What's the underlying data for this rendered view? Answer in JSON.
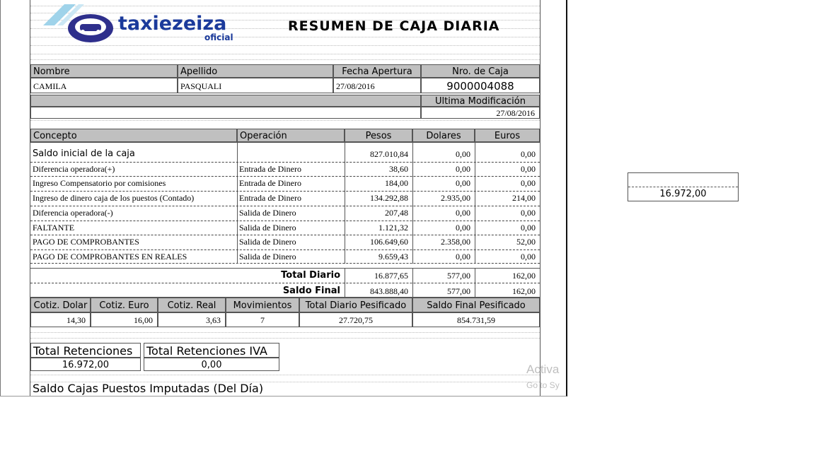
{
  "header": {
    "brand": "taxiezeiza",
    "brand_sub": "oficial",
    "title": "RESUMEN DE CAJA DIARIA"
  },
  "info": {
    "labels": {
      "nombre": "Nombre",
      "apellido": "Apellido",
      "fecha": "Fecha Apertura",
      "nro_caja": "Nro. de Caja",
      "ultima": "Ultima Modificación"
    },
    "nombre": "CAMILA",
    "apellido": "PASQUALI",
    "fecha": "27/08/2016",
    "nro_caja": "9000004088",
    "ultima": "27/08/2016"
  },
  "table": {
    "columns": [
      "Concepto",
      "Operación",
      "Pesos",
      "Dolares",
      "Euros"
    ],
    "rows": [
      {
        "concepto": "Saldo inicial de la caja",
        "operacion": "",
        "pesos": "827.010,84",
        "dolares": "0,00",
        "euros": "0,00"
      },
      {
        "concepto": "Diferencia operadora(+)",
        "operacion": "Entrada de Dinero",
        "pesos": "38,60",
        "dolares": "0,00",
        "euros": "0,00"
      },
      {
        "concepto": "Ingreso Compensatorio por comisiones",
        "operacion": "Entrada de Dinero",
        "pesos": "184,00",
        "dolares": "0,00",
        "euros": "0,00"
      },
      {
        "concepto": "Ingreso de dinero caja de los puestos (Contado)",
        "operacion": "Entrada de Dinero",
        "pesos": "134.292,88",
        "dolares": "2.935,00",
        "euros": "214,00"
      },
      {
        "concepto": "Diferencia operadora(-)",
        "operacion": "Salida de Dinero",
        "pesos": "207,48",
        "dolares": "0,00",
        "euros": "0,00"
      },
      {
        "concepto": "FALTANTE",
        "operacion": "Salida de Dinero",
        "pesos": "1.121,32",
        "dolares": "0,00",
        "euros": "0,00"
      },
      {
        "concepto": "PAGO DE COMPROBANTES",
        "operacion": "Salida de Dinero",
        "pesos": "106.649,60",
        "dolares": "2.358,00",
        "euros": "52,00"
      },
      {
        "concepto": "PAGO DE COMPROBANTES EN REALES",
        "operacion": "Salida de Dinero",
        "pesos": "9.659,43",
        "dolares": "0,00",
        "euros": "0,00"
      }
    ],
    "total_diario": {
      "label": "Total Diario",
      "pesos": "16.877,65",
      "dolares": "577,00",
      "euros": "162,00"
    },
    "saldo_final": {
      "label": "Saldo Final",
      "pesos": "843.888,40",
      "dolares": "577,00",
      "euros": "162,00"
    }
  },
  "cotiz": {
    "labels": [
      "Cotiz. Dolar",
      "Cotiz. Euro",
      "Cotiz. Real",
      "Movimientos",
      "Total Diario Pesificado",
      "Saldo Final Pesificado"
    ],
    "values": [
      "14,30",
      "16,00",
      "3,63",
      "7",
      "27.720,75",
      "854.731,59"
    ]
  },
  "retenciones": {
    "total_label": "Total Retenciones",
    "total_value": "16.972,00",
    "iva_label": "Total Retenciones IVA",
    "iva_value": "0,00"
  },
  "saldo_cajas": "Saldo Cajas Puestos Imputadas  (Del Día)",
  "side_box": {
    "value": "16.972,00"
  },
  "watermark": {
    "line1": "Activa",
    "line2": "Go to Sy"
  }
}
